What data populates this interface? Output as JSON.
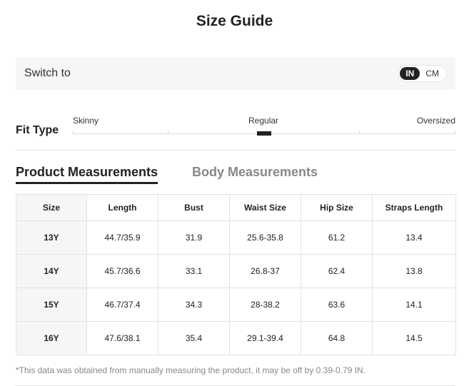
{
  "title": "Size Guide",
  "unit_switch": {
    "label": "Switch to",
    "options": [
      "IN",
      "CM"
    ],
    "selected": "IN"
  },
  "fit_type": {
    "label": "Fit Type",
    "options": [
      "Skinny",
      "Regular",
      "Oversized"
    ],
    "selected": "Regular"
  },
  "tabs": [
    {
      "label": "Product Measurements",
      "active": true
    },
    {
      "label": "Body Measurements",
      "active": false
    }
  ],
  "table": {
    "headers": [
      "Size",
      "Length",
      "Bust",
      "Waist Size",
      "Hip Size",
      "Straps Length"
    ],
    "rows": [
      [
        "13Y",
        "44.7/35.9",
        "31.9",
        "25.6-35.8",
        "61.2",
        "13.4"
      ],
      [
        "14Y",
        "45.7/36.6",
        "33.1",
        "26.8-37",
        "62.4",
        "13.8"
      ],
      [
        "15Y",
        "46.7/37.4",
        "34.3",
        "28-38.2",
        "63.6",
        "14.1"
      ],
      [
        "16Y",
        "47.6/38.1",
        "35.4",
        "29.1-39.4",
        "64.8",
        "14.5"
      ]
    ]
  },
  "footnote": "*This data was obtained from manually measuring the product, it may be off by 0.39-0.79 IN.",
  "colors": {
    "accent": "#222222",
    "muted": "#888888",
    "panel": "#f6f6f6"
  }
}
